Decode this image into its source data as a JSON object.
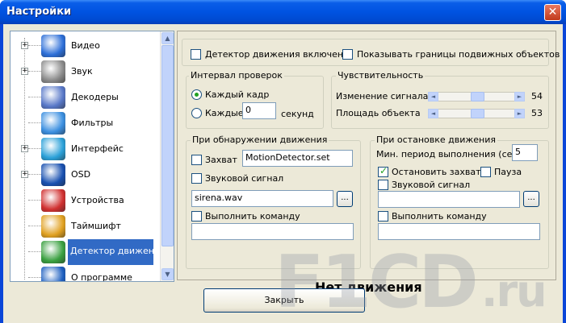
{
  "window": {
    "title": "Настройки",
    "close_glyph": "✕"
  },
  "tree": {
    "items": [
      {
        "label": "Видео",
        "icon": "monitor-icon",
        "color": "#2d6fd8",
        "expandable": true
      },
      {
        "label": "Звук",
        "icon": "speaker-icon",
        "color": "#8a8a8a",
        "expandable": true
      },
      {
        "label": "Декодеры",
        "icon": "gears-icon",
        "color": "#5878c8",
        "expandable": false
      },
      {
        "label": "Фильтры",
        "icon": "windows-icon",
        "color": "#3b8fe0",
        "expandable": false
      },
      {
        "label": "Интерфейс",
        "icon": "touch-icon",
        "color": "#2aa0d8",
        "expandable": true
      },
      {
        "label": "OSD",
        "icon": "letter-a-icon",
        "color": "#1850b0",
        "expandable": true
      },
      {
        "label": "Устройства",
        "icon": "shapes-icon",
        "color": "#d03030",
        "expandable": false
      },
      {
        "label": "Таймшифт",
        "icon": "clock-icon",
        "color": "#e0a020",
        "expandable": false
      },
      {
        "label": "Детектор движения",
        "icon": "shield-icon",
        "color": "#3aa040",
        "expandable": false,
        "selected": true
      },
      {
        "label": "О программе",
        "icon": "help-icon",
        "color": "#1d5fc0",
        "expandable": false
      }
    ],
    "scroll_up": "▲",
    "scroll_down": "▼"
  },
  "detector": {
    "enabled_label": "Детектор движения включен",
    "enabled": false,
    "show_bounds_label": "Показывать границы подвижных объектов",
    "show_bounds": false
  },
  "interval": {
    "title": "Интервал проверок",
    "every_frame_label": "Каждый кадр",
    "every_frame_selected": true,
    "every_label": "Каждые",
    "every_value": "0",
    "seconds_label": "секунд"
  },
  "sensitivity": {
    "title": "Чувствительность",
    "signal_label": "Изменение сигнала",
    "signal_value": "54",
    "area_label": "Площадь объекта",
    "area_value": "53",
    "arrow_left": "◄",
    "arrow_right": "►"
  },
  "on_detect": {
    "title": "При обнаружении движения",
    "capture_label": "Захват",
    "capture_checked": false,
    "capture_file": "MotionDetector.set",
    "sound_label": "Звуковой сигнал",
    "sound_checked": false,
    "sound_file": "sirena.wav",
    "browse_label": "...",
    "command_label": "Выполнить команду",
    "command_checked": false,
    "command_value": ""
  },
  "on_stop": {
    "title": "При остановке движения",
    "min_period_label": "Мин. период выполнения (сек)",
    "min_period_value": "5",
    "stop_capture_label": "Остановить захват",
    "stop_capture_checked": true,
    "pause_label": "Пауза",
    "pause_checked": false,
    "sound_label": "Звуковой сигнал",
    "sound_checked": false,
    "sound_file": "",
    "browse_label": "...",
    "command_label": "Выполнить команду",
    "command_checked": false,
    "command_value": ""
  },
  "status": {
    "text": "Нет движения"
  },
  "footer": {
    "close_label": "Закрыть"
  },
  "watermark": {
    "text": "F1CD",
    "suffix": ".ru"
  }
}
